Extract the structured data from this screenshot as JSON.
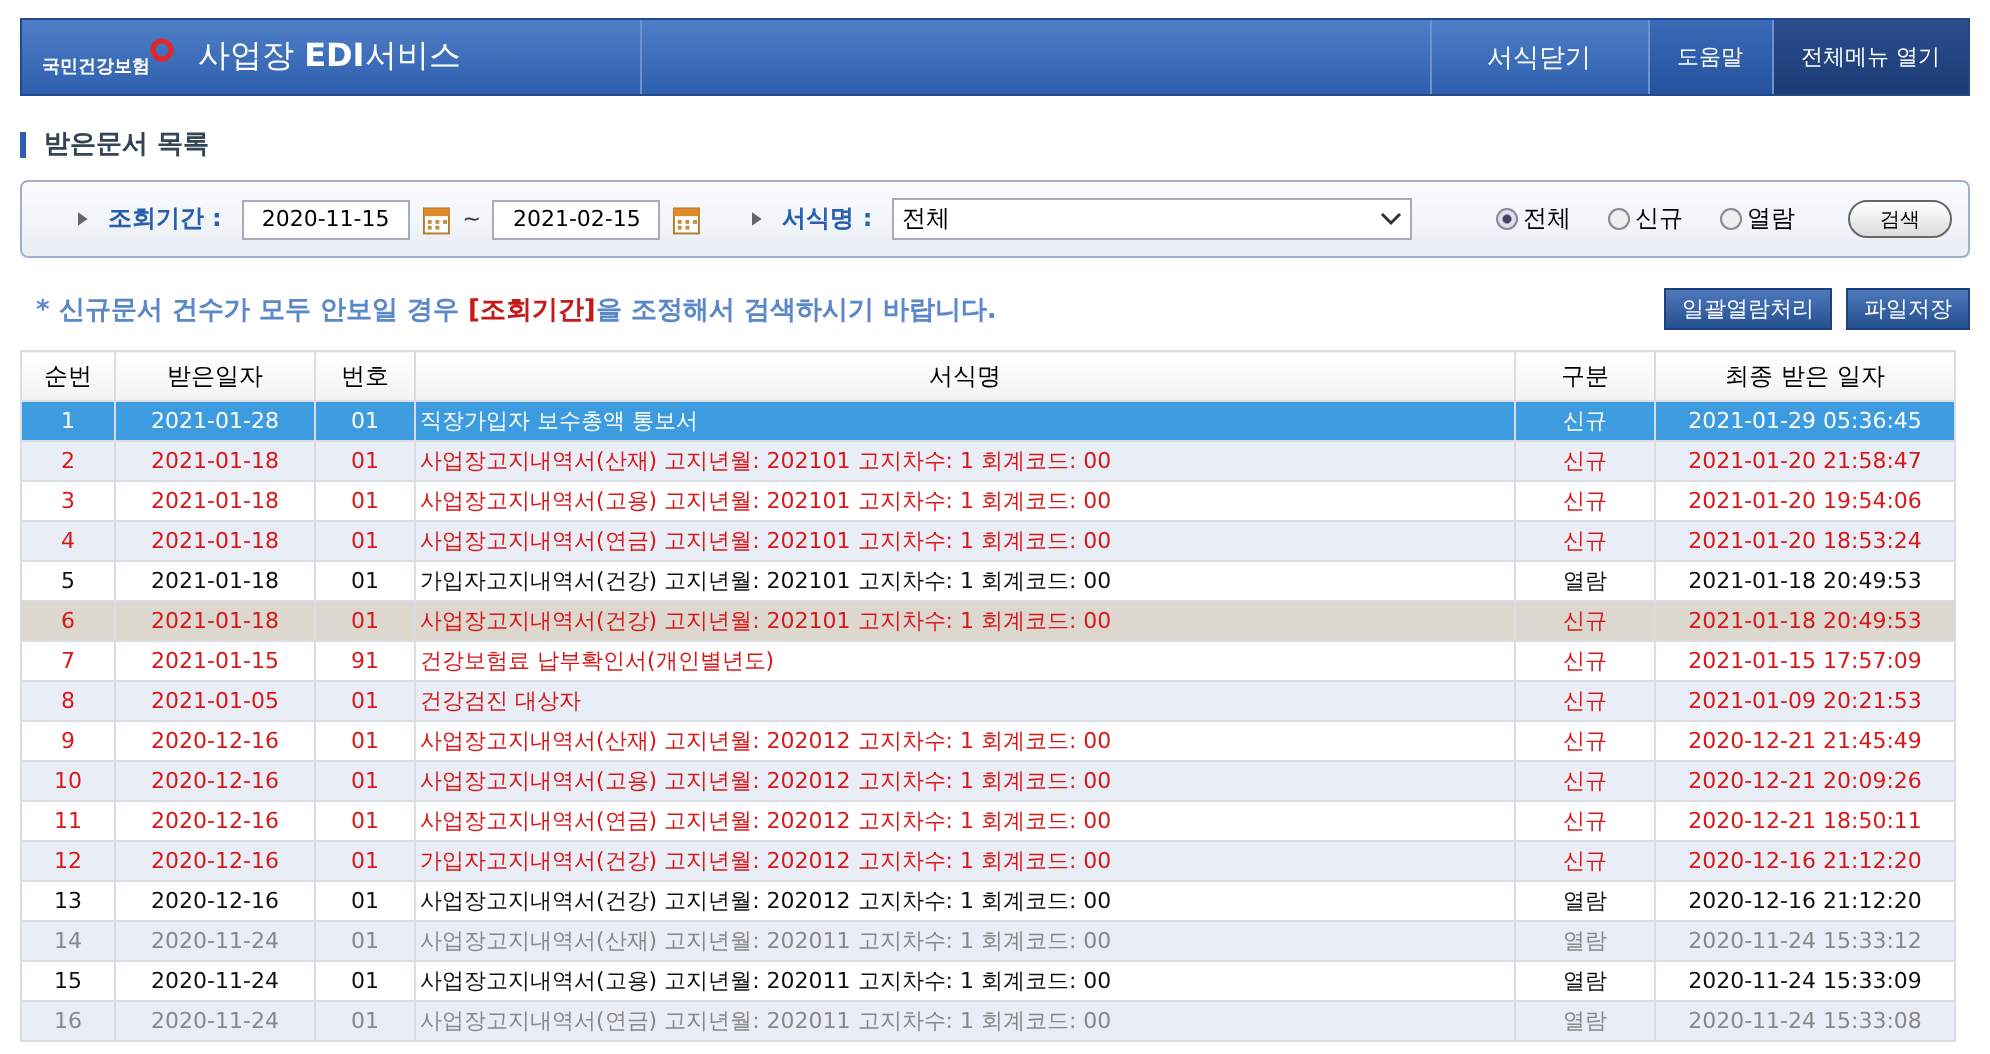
{
  "header": {
    "logo_text": "국민건강보험",
    "service_title": "사업장 **EDI**서비스",
    "nav": [
      {
        "label": "서식닫기",
        "kind": "primary"
      },
      {
        "label": "도움말",
        "kind": "secondary"
      },
      {
        "label": "전체메뉴 열기",
        "kind": "dark"
      }
    ]
  },
  "section_title": "받은문서 목록",
  "search": {
    "period_label": "조회기간 :",
    "start_date": "2020-11-15",
    "separator": "~",
    "end_date": "2021-02-15",
    "form_label": "서식명 :",
    "form_value": "전체",
    "radios": [
      {
        "label": "전체",
        "selected": true
      },
      {
        "label": "신규",
        "selected": false
      },
      {
        "label": "열람",
        "selected": false
      }
    ],
    "search_button": "검색"
  },
  "notice": "* 신규문서 건수가 모두 안보일 경우 **[조회기간]**을 조정해서 검색하시기 바랍니다.",
  "actions": [
    "일괄열람처리",
    "파일저장"
  ],
  "table": {
    "columns": [
      "순번",
      "받은일자",
      "번호",
      "서식명",
      "구분",
      "최종 받은 일자"
    ],
    "rows": [
      {
        "cells": [
          "1",
          "2021-01-28",
          "01",
          "직장가입자 보수총액 통보서",
          "신규",
          "2021-01-29 05:36:45"
        ],
        "unread": true,
        "dimmed": false,
        "selected": true,
        "hovered": false
      },
      {
        "cells": [
          "2",
          "2021-01-18",
          "01",
          "사업장고지내역서(산재) 고지년월: 202101 고지차수: 1 회계코드: 00",
          "신규",
          "2021-01-20 21:58:47"
        ],
        "unread": true,
        "dimmed": false,
        "selected": false,
        "hovered": false
      },
      {
        "cells": [
          "3",
          "2021-01-18",
          "01",
          "사업장고지내역서(고용) 고지년월: 202101 고지차수: 1 회계코드: 00",
          "신규",
          "2021-01-20 19:54:06"
        ],
        "unread": true,
        "dimmed": false,
        "selected": false,
        "hovered": false
      },
      {
        "cells": [
          "4",
          "2021-01-18",
          "01",
          "사업장고지내역서(연금) 고지년월: 202101 고지차수: 1 회계코드: 00",
          "신규",
          "2021-01-20 18:53:24"
        ],
        "unread": true,
        "dimmed": false,
        "selected": false,
        "hovered": false
      },
      {
        "cells": [
          "5",
          "2021-01-18",
          "01",
          "가입자고지내역서(건강) 고지년월: 202101 고지차수: 1 회계코드: 00",
          "열람",
          "2021-01-18 20:49:53"
        ],
        "unread": false,
        "dimmed": false,
        "selected": false,
        "hovered": false
      },
      {
        "cells": [
          "6",
          "2021-01-18",
          "01",
          "사업장고지내역서(건강) 고지년월: 202101 고지차수: 1 회계코드: 00",
          "신규",
          "2021-01-18 20:49:53"
        ],
        "unread": true,
        "dimmed": false,
        "selected": false,
        "hovered": true
      },
      {
        "cells": [
          "7",
          "2021-01-15",
          "91",
          "건강보험료 납부확인서(개인별년도)",
          "신규",
          "2021-01-15 17:57:09"
        ],
        "unread": true,
        "dimmed": false,
        "selected": false,
        "hovered": false
      },
      {
        "cells": [
          "8",
          "2021-01-05",
          "01",
          "건강검진 대상자",
          "신규",
          "2021-01-09 20:21:53"
        ],
        "unread": true,
        "dimmed": false,
        "selected": false,
        "hovered": false
      },
      {
        "cells": [
          "9",
          "2020-12-16",
          "01",
          "사업장고지내역서(산재) 고지년월: 202012 고지차수: 1 회계코드: 00",
          "신규",
          "2020-12-21 21:45:49"
        ],
        "unread": true,
        "dimmed": false,
        "selected": false,
        "hovered": false
      },
      {
        "cells": [
          "10",
          "2020-12-16",
          "01",
          "사업장고지내역서(고용) 고지년월: 202012 고지차수: 1 회계코드: 00",
          "신규",
          "2020-12-21 20:09:26"
        ],
        "unread": true,
        "dimmed": false,
        "selected": false,
        "hovered": false
      },
      {
        "cells": [
          "11",
          "2020-12-16",
          "01",
          "사업장고지내역서(연금) 고지년월: 202012 고지차수: 1 회계코드: 00",
          "신규",
          "2020-12-21 18:50:11"
        ],
        "unread": true,
        "dimmed": false,
        "selected": false,
        "hovered": false
      },
      {
        "cells": [
          "12",
          "2020-12-16",
          "01",
          "가입자고지내역서(건강) 고지년월: 202012 고지차수: 1 회계코드: 00",
          "신규",
          "2020-12-16 21:12:20"
        ],
        "unread": true,
        "dimmed": false,
        "selected": false,
        "hovered": false
      },
      {
        "cells": [
          "13",
          "2020-12-16",
          "01",
          "사업장고지내역서(건강) 고지년월: 202012 고지차수: 1 회계코드: 00",
          "열람",
          "2020-12-16 21:12:20"
        ],
        "unread": false,
        "dimmed": false,
        "selected": false,
        "hovered": false
      },
      {
        "cells": [
          "14",
          "2020-11-24",
          "01",
          "사업장고지내역서(산재) 고지년월: 202011 고지차수: 1 회계코드: 00",
          "열람",
          "2020-11-24 15:33:12"
        ],
        "unread": false,
        "dimmed": true,
        "selected": false,
        "hovered": false
      },
      {
        "cells": [
          "15",
          "2020-11-24",
          "01",
          "사업장고지내역서(고용) 고지년월: 202011 고지차수: 1 회계코드: 00",
          "열람",
          "2020-11-24 15:33:09"
        ],
        "unread": false,
        "dimmed": false,
        "selected": false,
        "hovered": false
      },
      {
        "cells": [
          "16",
          "2020-11-24",
          "01",
          "사업장고지내역서(연금) 고지년월: 202011 고지차수: 1 회계코드: 00",
          "열람",
          "2020-11-24 15:33:08"
        ],
        "unread": false,
        "dimmed": true,
        "selected": false,
        "hovered": false
      }
    ]
  }
}
